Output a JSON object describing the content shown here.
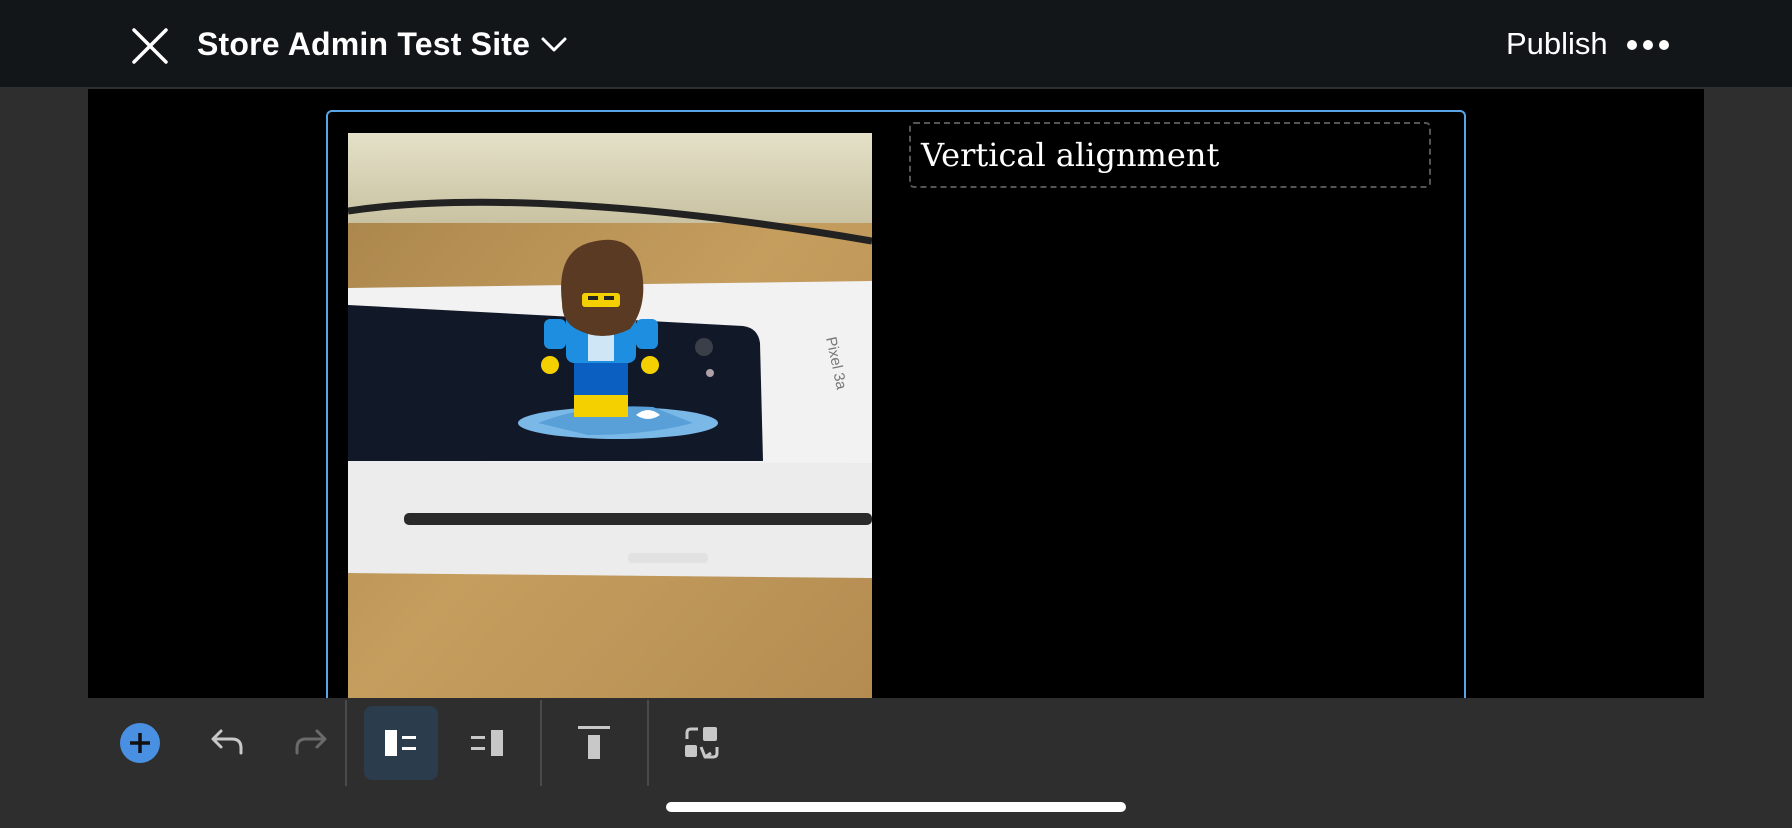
{
  "header": {
    "site_title": "Store Admin Test Site",
    "publish_label": "Publish",
    "close_icon": "close-icon",
    "title_dropdown_icon": "chevron-down-icon",
    "more_icon": "more-horizontal-icon"
  },
  "editor": {
    "heading_text": "Vertical alignment",
    "image_description": "lego-figure-surfboard-photo",
    "image_visible_text": "Pixel 3a"
  },
  "toolbar": {
    "items": [
      {
        "name": "add-block-button",
        "icon": "plus-circle-icon"
      },
      {
        "name": "undo-button",
        "icon": "undo-icon"
      },
      {
        "name": "redo-button",
        "icon": "redo-icon",
        "disabled": true
      },
      {
        "name": "media-left-button",
        "icon": "media-left-icon",
        "active": true
      },
      {
        "name": "media-right-button",
        "icon": "media-right-icon"
      },
      {
        "name": "align-top-button",
        "icon": "align-top-icon"
      },
      {
        "name": "replace-button",
        "icon": "replace-icon"
      }
    ]
  },
  "colors": {
    "accent": "#4a90e2",
    "header_bg": "#121619",
    "selection_border": "#5aa4e8",
    "active_button_bg": "#2b3c4c"
  }
}
